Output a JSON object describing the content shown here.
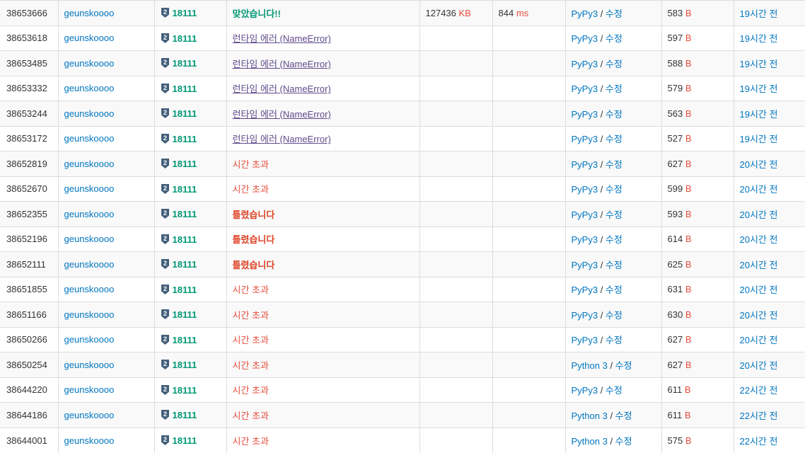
{
  "tier_color": "#435f7a",
  "units": {
    "memory": "KB",
    "time": "ms",
    "length": "B"
  },
  "lang_edit_sep": " / ",
  "rows": [
    {
      "id": "38653666",
      "user": "geunskoooo",
      "problem": "18111",
      "result": "맞았습니다!!",
      "result_type": "ac",
      "rte_detail": "",
      "memory": "127436",
      "time": "844",
      "lang": "PyPy3",
      "edit": "수정",
      "length": "583",
      "submitted": "19시간 전"
    },
    {
      "id": "38653618",
      "user": "geunskoooo",
      "problem": "18111",
      "result": "런타임 에러",
      "result_type": "rte",
      "rte_detail": "(NameError)",
      "memory": "",
      "time": "",
      "lang": "PyPy3",
      "edit": "수정",
      "length": "597",
      "submitted": "19시간 전"
    },
    {
      "id": "38653485",
      "user": "geunskoooo",
      "problem": "18111",
      "result": "런타임 에러",
      "result_type": "rte",
      "rte_detail": "(NameError)",
      "memory": "",
      "time": "",
      "lang": "PyPy3",
      "edit": "수정",
      "length": "588",
      "submitted": "19시간 전"
    },
    {
      "id": "38653332",
      "user": "geunskoooo",
      "problem": "18111",
      "result": "런타임 에러",
      "result_type": "rte",
      "rte_detail": "(NameError)",
      "memory": "",
      "time": "",
      "lang": "PyPy3",
      "edit": "수정",
      "length": "579",
      "submitted": "19시간 전"
    },
    {
      "id": "38653244",
      "user": "geunskoooo",
      "problem": "18111",
      "result": "런타임 에러",
      "result_type": "rte",
      "rte_detail": "(NameError)",
      "memory": "",
      "time": "",
      "lang": "PyPy3",
      "edit": "수정",
      "length": "563",
      "submitted": "19시간 전"
    },
    {
      "id": "38653172",
      "user": "geunskoooo",
      "problem": "18111",
      "result": "런타임 에러",
      "result_type": "rte",
      "rte_detail": "(NameError)",
      "memory": "",
      "time": "",
      "lang": "PyPy3",
      "edit": "수정",
      "length": "527",
      "submitted": "19시간 전"
    },
    {
      "id": "38652819",
      "user": "geunskoooo",
      "problem": "18111",
      "result": "시간 초과",
      "result_type": "tle",
      "rte_detail": "",
      "memory": "",
      "time": "",
      "lang": "PyPy3",
      "edit": "수정",
      "length": "627",
      "submitted": "20시간 전"
    },
    {
      "id": "38652670",
      "user": "geunskoooo",
      "problem": "18111",
      "result": "시간 초과",
      "result_type": "tle",
      "rte_detail": "",
      "memory": "",
      "time": "",
      "lang": "PyPy3",
      "edit": "수정",
      "length": "599",
      "submitted": "20시간 전"
    },
    {
      "id": "38652355",
      "user": "geunskoooo",
      "problem": "18111",
      "result": "틀렸습니다",
      "result_type": "wa",
      "rte_detail": "",
      "memory": "",
      "time": "",
      "lang": "PyPy3",
      "edit": "수정",
      "length": "593",
      "submitted": "20시간 전"
    },
    {
      "id": "38652196",
      "user": "geunskoooo",
      "problem": "18111",
      "result": "틀렸습니다",
      "result_type": "wa",
      "rte_detail": "",
      "memory": "",
      "time": "",
      "lang": "PyPy3",
      "edit": "수정",
      "length": "614",
      "submitted": "20시간 전"
    },
    {
      "id": "38652111",
      "user": "geunskoooo",
      "problem": "18111",
      "result": "틀렸습니다",
      "result_type": "wa",
      "rte_detail": "",
      "memory": "",
      "time": "",
      "lang": "PyPy3",
      "edit": "수정",
      "length": "625",
      "submitted": "20시간 전"
    },
    {
      "id": "38651855",
      "user": "geunskoooo",
      "problem": "18111",
      "result": "시간 초과",
      "result_type": "tle",
      "rte_detail": "",
      "memory": "",
      "time": "",
      "lang": "PyPy3",
      "edit": "수정",
      "length": "631",
      "submitted": "20시간 전"
    },
    {
      "id": "38651166",
      "user": "geunskoooo",
      "problem": "18111",
      "result": "시간 초과",
      "result_type": "tle",
      "rte_detail": "",
      "memory": "",
      "time": "",
      "lang": "PyPy3",
      "edit": "수정",
      "length": "630",
      "submitted": "20시간 전"
    },
    {
      "id": "38650266",
      "user": "geunskoooo",
      "problem": "18111",
      "result": "시간 초과",
      "result_type": "tle",
      "rte_detail": "",
      "memory": "",
      "time": "",
      "lang": "PyPy3",
      "edit": "수정",
      "length": "627",
      "submitted": "20시간 전"
    },
    {
      "id": "38650254",
      "user": "geunskoooo",
      "problem": "18111",
      "result": "시간 초과",
      "result_type": "tle",
      "rte_detail": "",
      "memory": "",
      "time": "",
      "lang": "Python 3",
      "edit": "수정",
      "length": "627",
      "submitted": "20시간 전"
    },
    {
      "id": "38644220",
      "user": "geunskoooo",
      "problem": "18111",
      "result": "시간 초과",
      "result_type": "tle",
      "rte_detail": "",
      "memory": "",
      "time": "",
      "lang": "PyPy3",
      "edit": "수정",
      "length": "611",
      "submitted": "22시간 전"
    },
    {
      "id": "38644186",
      "user": "geunskoooo",
      "problem": "18111",
      "result": "시간 초과",
      "result_type": "tle",
      "rte_detail": "",
      "memory": "",
      "time": "",
      "lang": "Python 3",
      "edit": "수정",
      "length": "611",
      "submitted": "22시간 전"
    },
    {
      "id": "38644001",
      "user": "geunskoooo",
      "problem": "18111",
      "result": "시간 초과",
      "result_type": "tle",
      "rte_detail": "",
      "memory": "",
      "time": "",
      "lang": "Python 3",
      "edit": "수정",
      "length": "575",
      "submitted": "22시간 전"
    }
  ]
}
